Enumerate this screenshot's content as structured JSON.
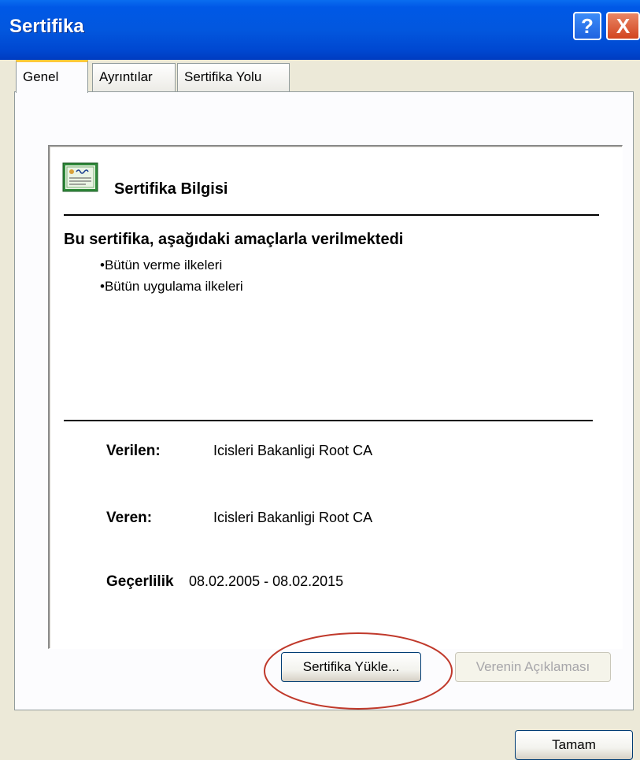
{
  "window": {
    "title": "Sertifika",
    "help_glyph": "?",
    "close_glyph": "X"
  },
  "tabs": [
    {
      "label": "Genel",
      "active": true
    },
    {
      "label": "Ayrıntılar",
      "active": false
    },
    {
      "label": "Sertifika Yolu",
      "active": false
    }
  ],
  "info": {
    "icon": "certificate-icon",
    "heading": "Sertifika Bilgisi",
    "purpose_title": "Bu sertifika, aşağıdaki amaçlarla verilmektedi",
    "purposes": [
      "•Bütün verme ilkeleri",
      "•Bütün uygulama ilkeleri"
    ],
    "issued_to_label": "Verilen:",
    "issued_to_value": "Icisleri Bakanligi Root CA",
    "issued_by_label": "Veren:",
    "issued_by_value": "Icisleri Bakanligi Root CA",
    "validity_label": "Geçerlilik",
    "validity_value": "08.02.2005 - 08.02.2015"
  },
  "buttons": {
    "install": "Sertifika Yükle...",
    "issuer_statement": "Verenin Açıklaması",
    "ok": "Tamam"
  },
  "colors": {
    "titlebar": "#0058e6",
    "tab_active_accent": "#ffc83c",
    "highlight_oval": "#c0392b"
  }
}
